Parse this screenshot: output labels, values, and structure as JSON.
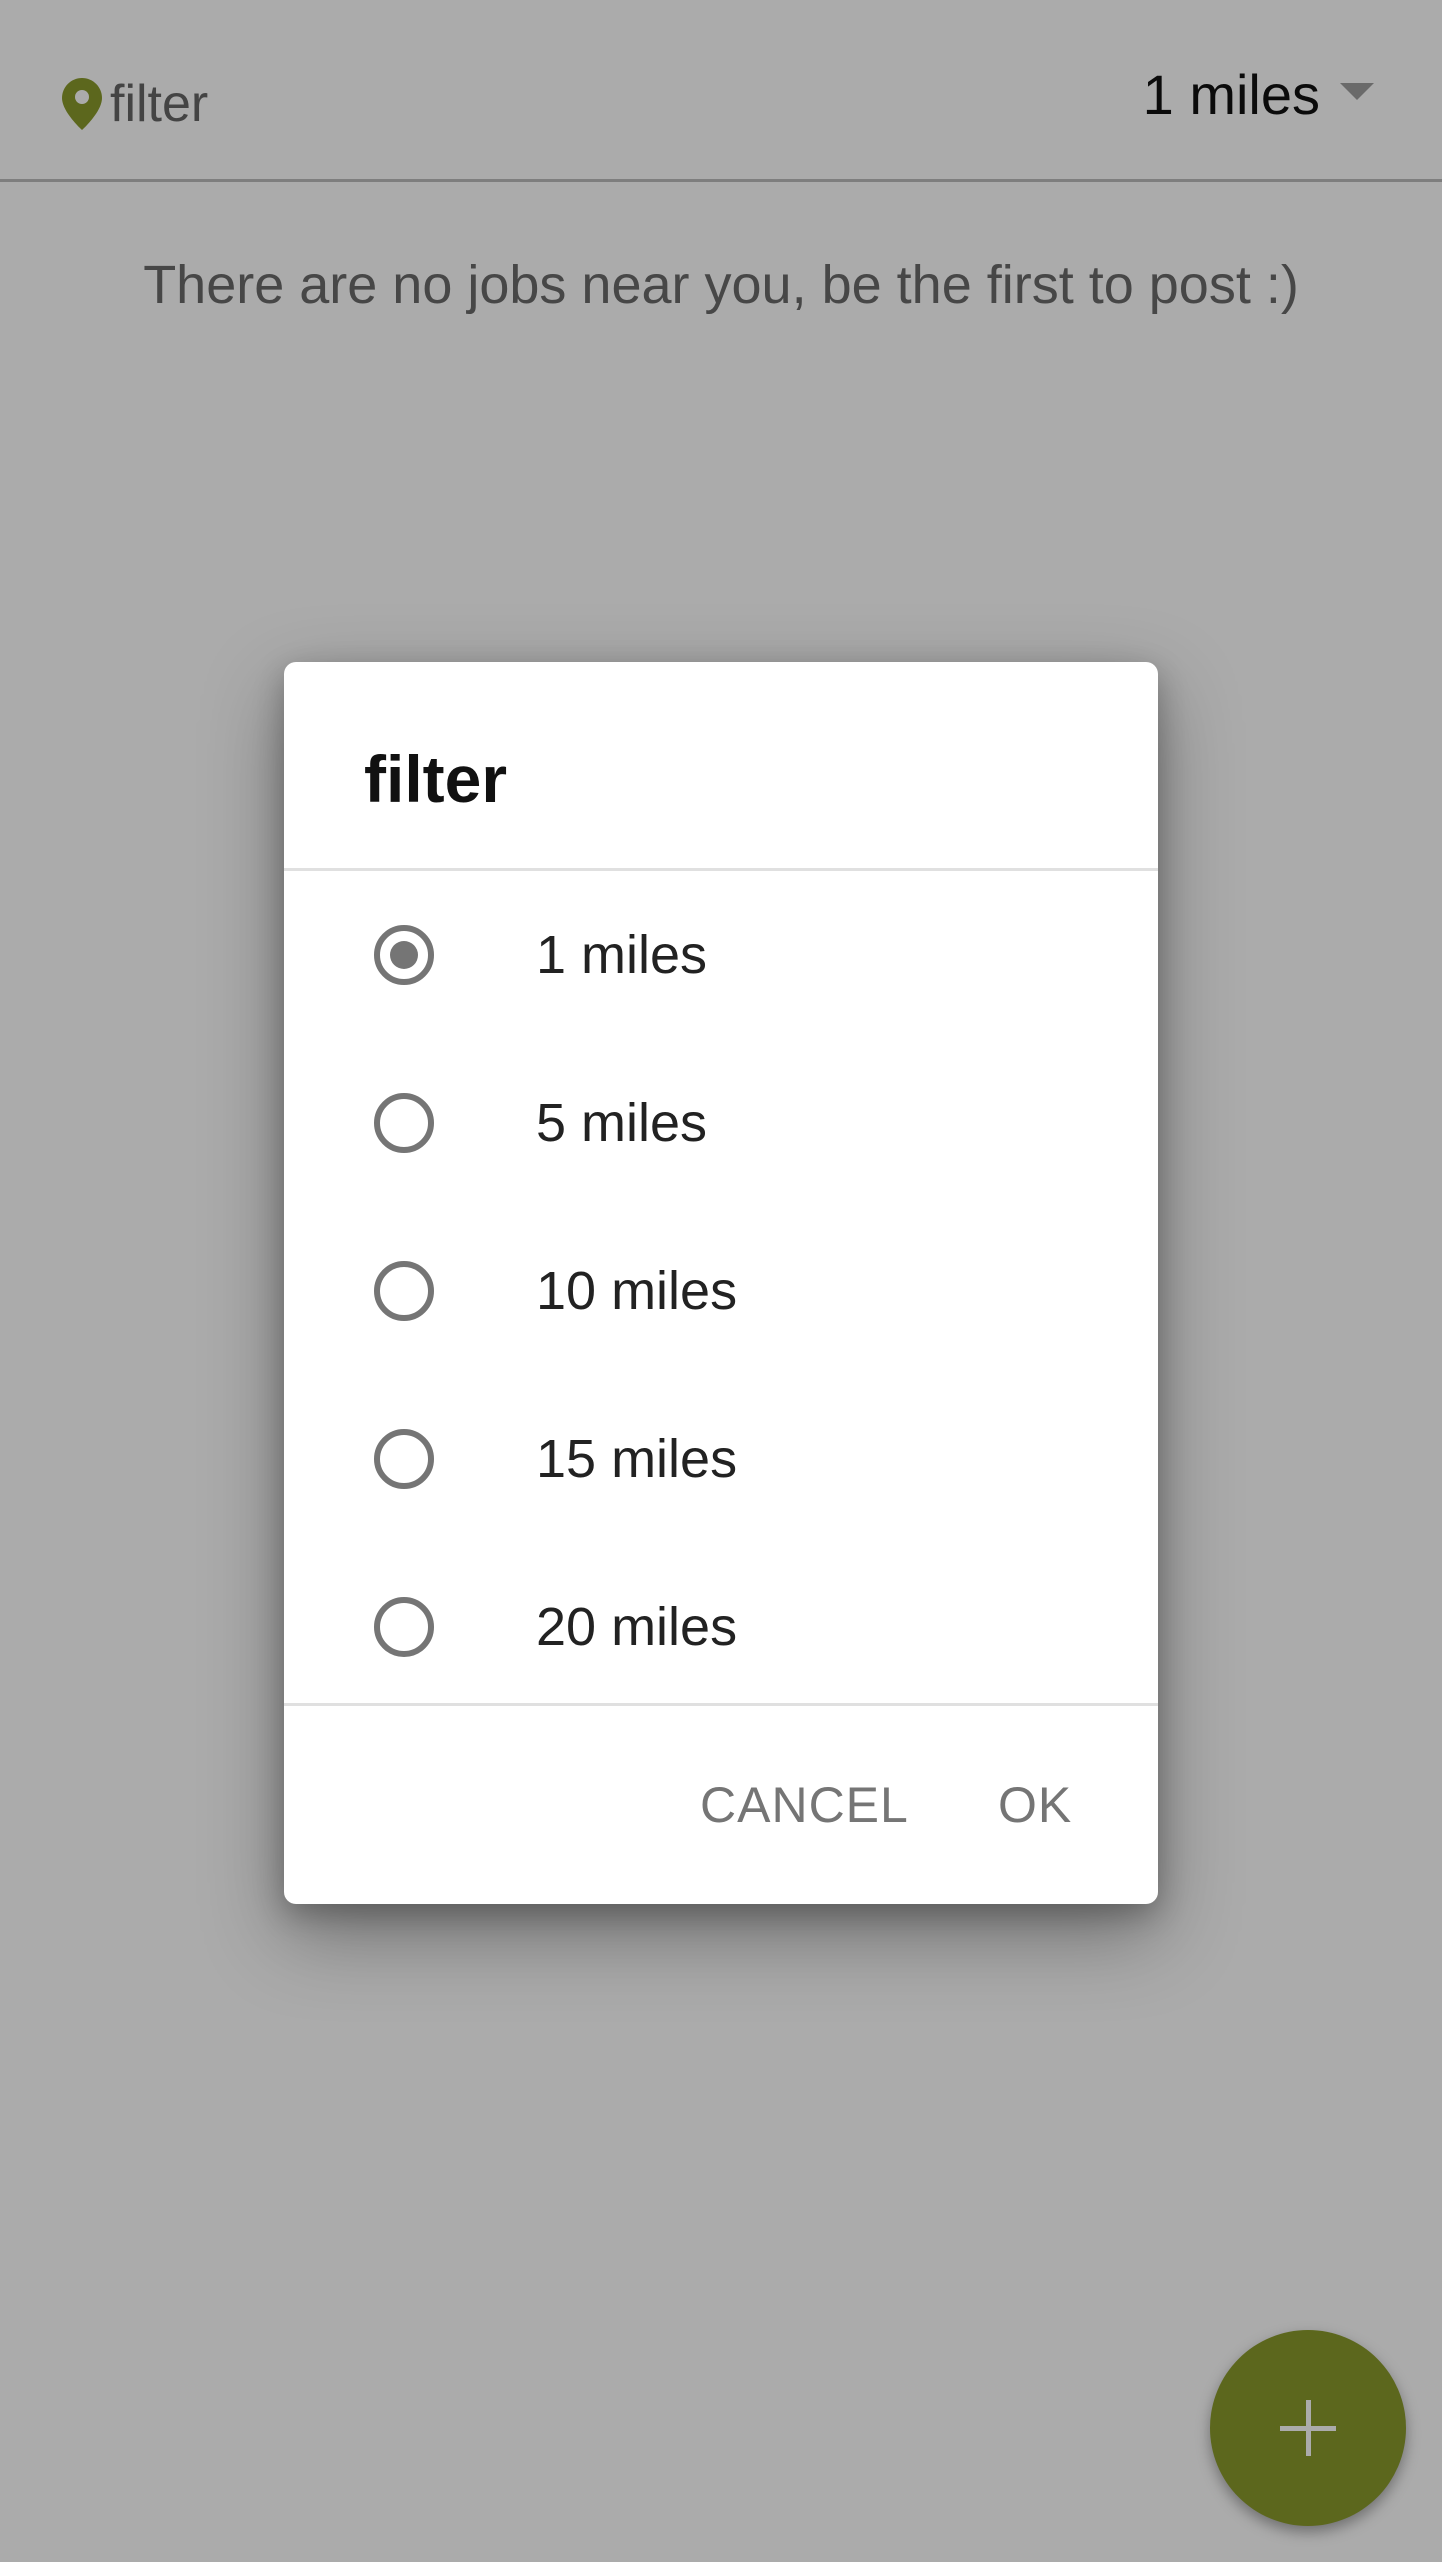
{
  "header": {
    "filter_label": "filter",
    "selected_distance": "1 miles"
  },
  "main": {
    "empty_message": "There are no jobs near you, be the first to post :)"
  },
  "dialog": {
    "title": "filter",
    "options": [
      {
        "label": "1 miles",
        "selected": true
      },
      {
        "label": "5 miles",
        "selected": false
      },
      {
        "label": "10 miles",
        "selected": false
      },
      {
        "label": "15 miles",
        "selected": false
      },
      {
        "label": "20 miles",
        "selected": false
      }
    ],
    "cancel_label": "CANCEL",
    "ok_label": "OK"
  },
  "colors": {
    "accent": "#8a9a2c",
    "radio": "#757575"
  },
  "icons": {
    "location": "map-pin-icon",
    "dropdown": "caret-down-icon",
    "fab": "plus-icon"
  }
}
